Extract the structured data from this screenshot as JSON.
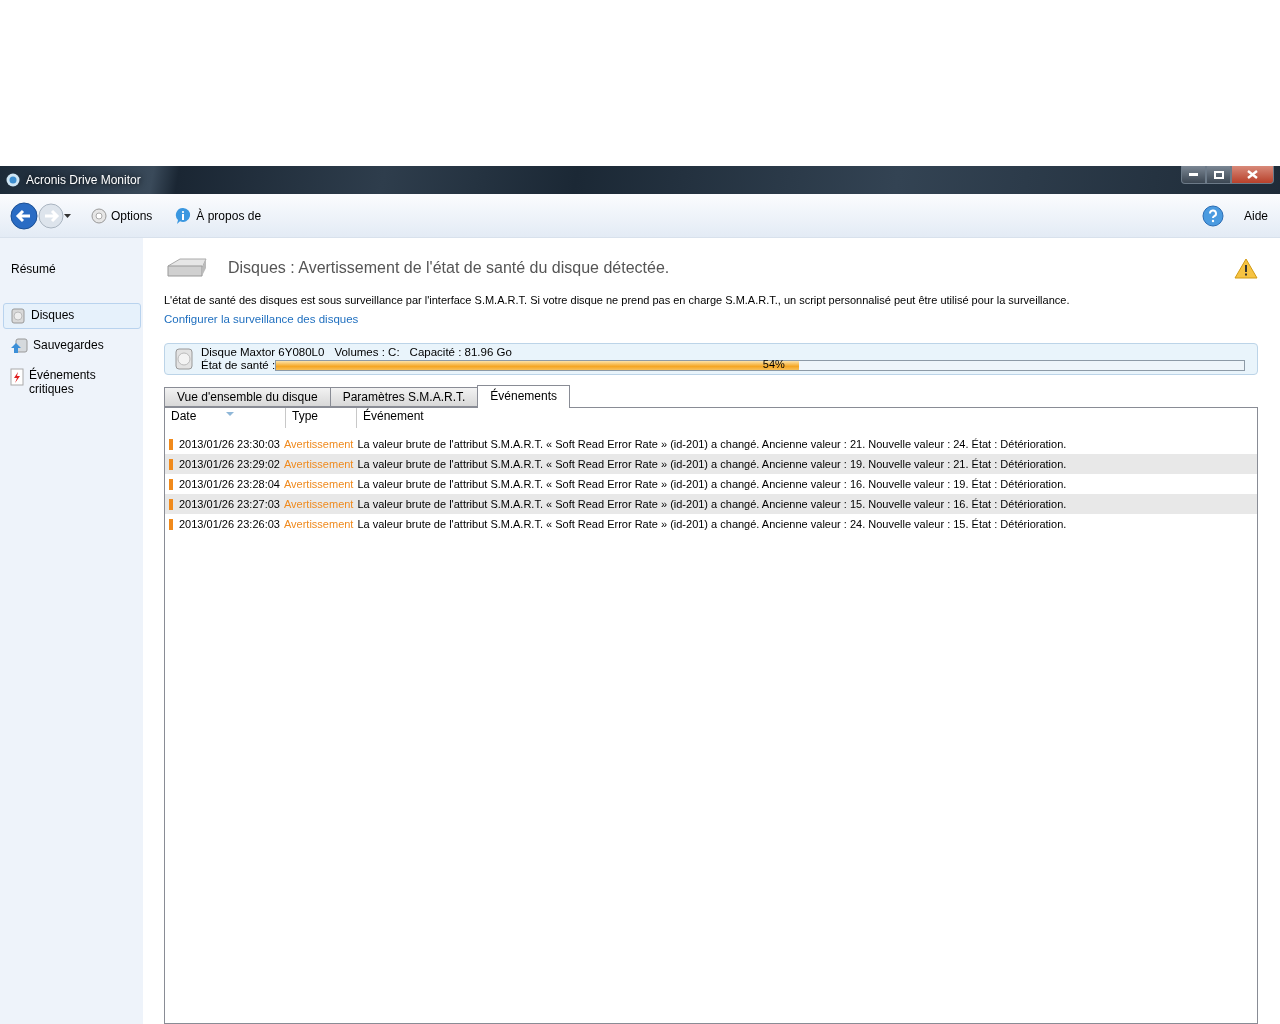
{
  "window": {
    "title": "Acronis Drive Monitor"
  },
  "toolbar": {
    "items": [
      {
        "kind": "options",
        "label": "Options"
      },
      {
        "kind": "about",
        "label": "À propos de"
      }
    ],
    "help": "Aide"
  },
  "sidebar": {
    "summary": "Résumé",
    "items": [
      {
        "kind": "disk",
        "label": "Disques",
        "selected": true
      },
      {
        "kind": "backup",
        "label": "Sauvegardes",
        "selected": false
      },
      {
        "kind": "critical",
        "label": "Événements critiques",
        "selected": false
      }
    ]
  },
  "header": {
    "title": "Disques : Avertissement de l'état de santé du disque détectée.",
    "description": "L'état de santé des disques est sous surveillance par l'interface S.M.A.R.T. Si votre disque ne prend pas en charge S.M.A.R.T., un script personnalisé peut être utilisé pour la surveillance.",
    "link": "Configurer la surveillance des disques"
  },
  "disk": {
    "name": "Disque Maxtor 6Y080L0",
    "volumes": "Volumes : C:",
    "capacity": "Capacité : 81.96 Go",
    "health_label": "État de santé :",
    "level": 0.54,
    "reading": "54%"
  },
  "tabs": [
    {
      "label": "Vue d'ensemble du disque",
      "selected": false
    },
    {
      "label": "Paramètres S.M.A.R.T.",
      "selected": false
    },
    {
      "label": "Événements",
      "selected": true
    }
  ],
  "table": {
    "columns": [
      "Date",
      "Type",
      "Événement"
    ],
    "rows": [
      {
        "date": "2013/01/26 23:30:03",
        "type": "Avertissement",
        "event": "La valeur brute de l'attribut S.M.A.R.T. « Soft Read Error Rate » (id-201) a changé. Ancienne valeur : 21. Nouvelle valeur : 24. État : Détérioration."
      },
      {
        "date": "2013/01/26 23:29:02",
        "type": "Avertissement",
        "event": "La valeur brute de l'attribut S.M.A.R.T. « Soft Read Error Rate » (id-201) a changé. Ancienne valeur : 19. Nouvelle valeur : 21. État : Détérioration."
      },
      {
        "date": "2013/01/26 23:28:04",
        "type": "Avertissement",
        "event": "La valeur brute de l'attribut S.M.A.R.T. « Soft Read Error Rate » (id-201) a changé. Ancienne valeur : 16. Nouvelle valeur : 19. État : Détérioration."
      },
      {
        "date": "2013/01/26 23:27:03",
        "type": "Avertissement",
        "event": "La valeur brute de l'attribut S.M.A.R.T. « Soft Read Error Rate » (id-201) a changé. Ancienne valeur : 15. Nouvelle valeur : 16. État : Détérioration."
      },
      {
        "date": "2013/01/26 23:26:03",
        "type": "Avertissement",
        "event": "La valeur brute de l'attribut S.M.A.R.T. « Soft Read Error Rate » (id-201) a changé. Ancienne valeur : 24. Nouvelle valeur : 15. État : Détérioration."
      }
    ]
  }
}
